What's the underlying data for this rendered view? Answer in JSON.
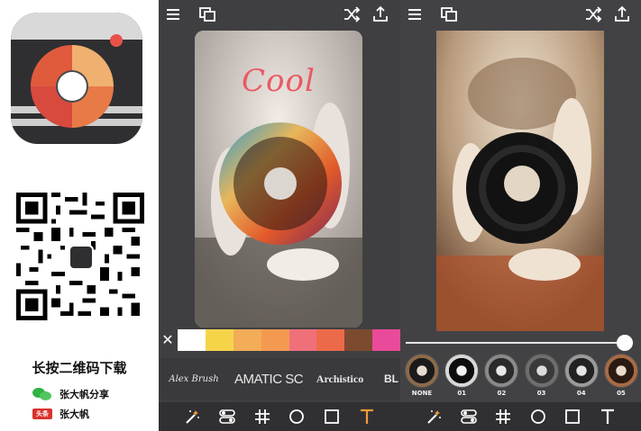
{
  "promo": {
    "title": "长按二维码下载",
    "wechat_label": "张大帆分享",
    "toutiao_badge": "头条",
    "toutiao_label": "张大帆"
  },
  "screen_a": {
    "overlay_text": "Cool",
    "swatches": [
      "#ffffff",
      "#f6d44a",
      "#f3ac57",
      "#f39a50",
      "#f0707a",
      "#ec6a48",
      "#7c4a2f",
      "#ea4a9a"
    ],
    "fonts": [
      "Alex Brush",
      "AMATIC SC",
      "Archistico",
      "BL"
    ],
    "active_tool": "text"
  },
  "screen_b": {
    "slider_value": 1.0,
    "filters": [
      "NONE",
      "01",
      "02",
      "03",
      "04",
      "05"
    ]
  },
  "colors": {
    "panel_bg": "#3f3f42",
    "toolbar_bg": "#303033",
    "accent_orange": "#f29a3b",
    "text_pink": "#e85a64"
  },
  "icons": {
    "top_left": [
      "menu-icon",
      "layers-icon"
    ],
    "top_right": [
      "shuffle-icon",
      "share-icon"
    ],
    "bottom": [
      "magic-wand-icon",
      "toggle-icon",
      "grid-icon",
      "circle-icon",
      "square-icon",
      "text-icon"
    ]
  }
}
